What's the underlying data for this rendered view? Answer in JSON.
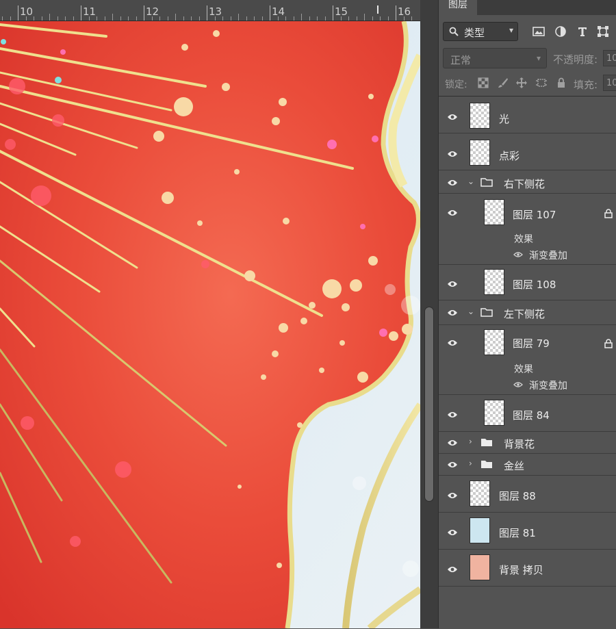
{
  "ruler": {
    "labels": [
      "10",
      "11",
      "12",
      "13",
      "14",
      "15",
      "16"
    ]
  },
  "panel": {
    "tab_label": "图层",
    "filter_label": "类型",
    "blend_mode": "正常",
    "opacity_label": "不透明度:",
    "opacity_value": "10",
    "lock_label": "锁定:",
    "fill_label": "填充:",
    "fill_value": "10"
  },
  "layers": {
    "guang": "光",
    "dianCai": "点彩",
    "group_right": "右下侧花",
    "layer107": "图层 107",
    "fx107": "效果",
    "fx107_item": "渐变叠加",
    "layer108": "图层 108",
    "group_left": "左下侧花",
    "layer79": "图层 79",
    "fx79": "效果",
    "fx79_item": "渐变叠加",
    "layer84": "图层 84",
    "group_bg_flower": "背景花",
    "group_gold": "金丝",
    "layer88": "图层 88",
    "layer81": "图层 81",
    "bg_copy": "背景 拷贝"
  },
  "colors": {
    "canvas_red": "#e84a3a",
    "gold": "#e8d98a",
    "panel_bg": "#535353",
    "bg_copy_thumb": "#f0b3a0",
    "layer81_thumb": "#cde6f0"
  }
}
